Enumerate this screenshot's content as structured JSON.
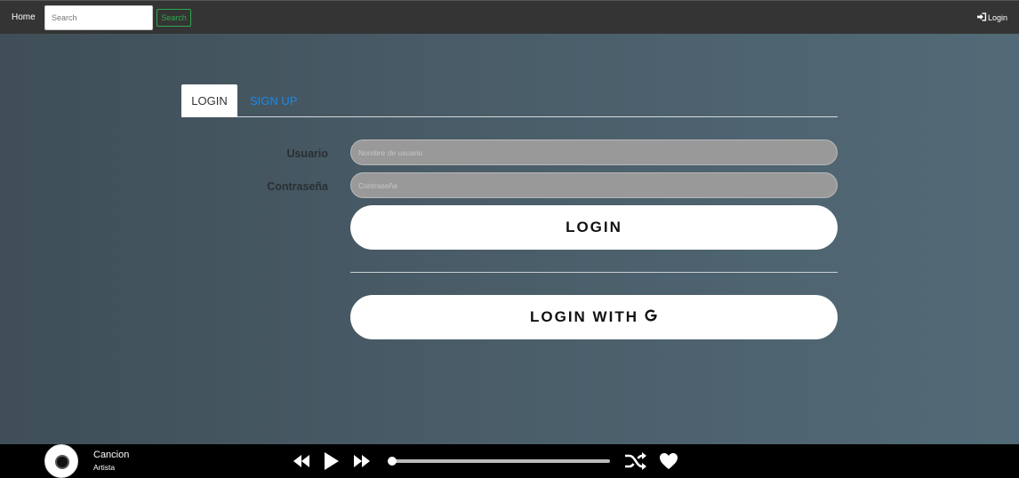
{
  "navbar": {
    "home_label": "Home",
    "search_placeholder": "Search",
    "search_button_label": "Search",
    "login_label": "Login"
  },
  "tabs": [
    {
      "label": "LOGIN",
      "active": true
    },
    {
      "label": "SIGN UP",
      "active": false
    }
  ],
  "form": {
    "username_label": "Usuario",
    "username_placeholder": "Nombre de usuario",
    "password_label": "Contraseña",
    "password_placeholder": "Contraseña",
    "login_button_label": "LOGIN",
    "google_button_label": "LOGIN WITH"
  },
  "player": {
    "song_title": "Cancion",
    "artist": "Artista",
    "progress": 0
  },
  "colors": {
    "navbar_bg": "#343434",
    "search_button": "#2fa84f",
    "tab_signup": "#1a8ae8",
    "player_bg": "#000000"
  },
  "icons": {
    "nav_login": "sign-in-icon",
    "google": "google-g-icon",
    "rewind": "backward-icon",
    "play": "play-icon",
    "forward": "forward-icon",
    "shuffle": "shuffle-icon",
    "favorite": "heart-icon",
    "album": "disc-icon"
  }
}
